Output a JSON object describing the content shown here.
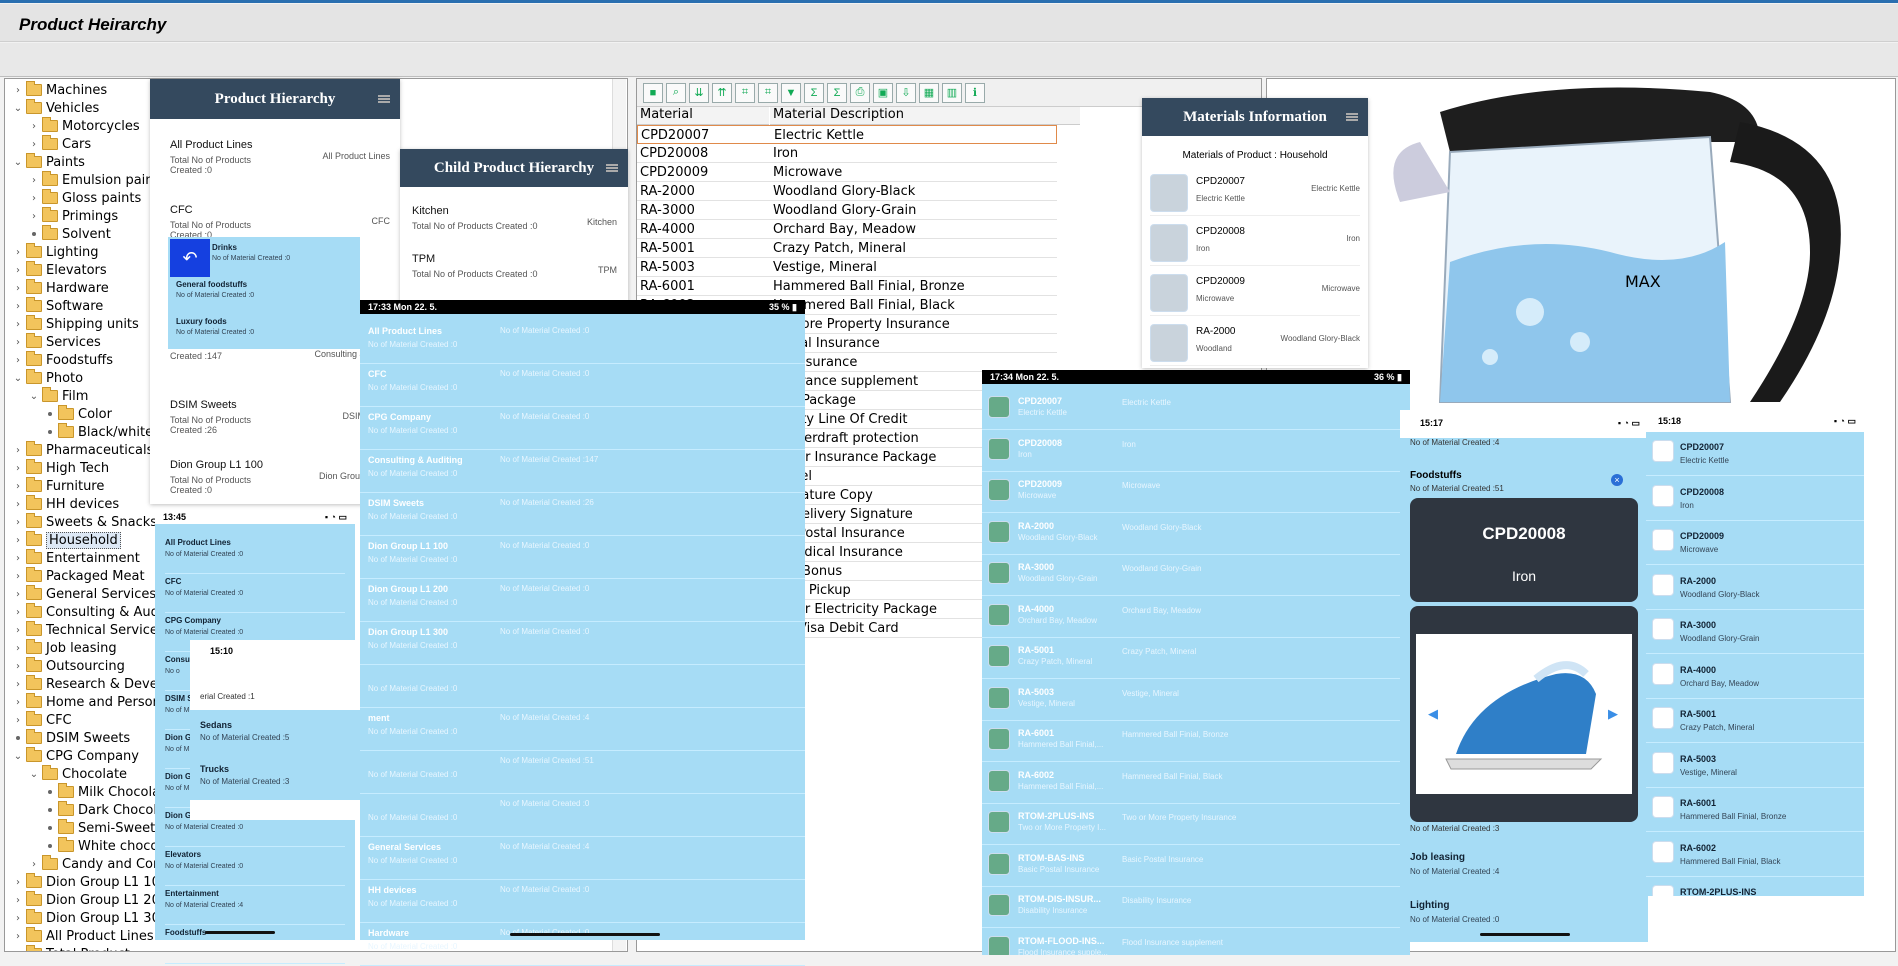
{
  "window": {
    "title": "Product Heirarchy"
  },
  "tree": [
    {
      "label": "Machines",
      "tw": "›",
      "d": 0
    },
    {
      "label": "Vehicles",
      "tw": "⌄",
      "d": 0
    },
    {
      "label": "Motorcycles",
      "tw": "›",
      "d": 1
    },
    {
      "label": "Cars",
      "tw": "›",
      "d": 1
    },
    {
      "label": "Paints",
      "tw": "⌄",
      "d": 0
    },
    {
      "label": "Emulsion paints",
      "tw": "›",
      "d": 1
    },
    {
      "label": "Gloss paints",
      "tw": "›",
      "d": 1
    },
    {
      "label": "Primings",
      "tw": "›",
      "d": 1
    },
    {
      "label": "Solvent",
      "tw": "•",
      "d": 1
    },
    {
      "label": "Lighting",
      "tw": "›",
      "d": 0
    },
    {
      "label": "Elevators",
      "tw": "›",
      "d": 0
    },
    {
      "label": "Hardware",
      "tw": "›",
      "d": 0
    },
    {
      "label": "Software",
      "tw": "›",
      "d": 0
    },
    {
      "label": "Shipping units",
      "tw": "›",
      "d": 0
    },
    {
      "label": "Services",
      "tw": "›",
      "d": 0
    },
    {
      "label": "Foodstuffs",
      "tw": "›",
      "d": 0
    },
    {
      "label": "Photo",
      "tw": "⌄",
      "d": 0
    },
    {
      "label": "Film",
      "tw": "⌄",
      "d": 1
    },
    {
      "label": "Color",
      "tw": "•",
      "d": 2
    },
    {
      "label": "Black/white",
      "tw": "•",
      "d": 2
    },
    {
      "label": "Pharmaceuticals",
      "tw": "›",
      "d": 0
    },
    {
      "label": "High Tech",
      "tw": "›",
      "d": 0
    },
    {
      "label": "Furniture",
      "tw": "›",
      "d": 0
    },
    {
      "label": "HH devices",
      "tw": "›",
      "d": 0
    },
    {
      "label": "Sweets & Snacks",
      "tw": "›",
      "d": 0
    },
    {
      "label": "Household",
      "tw": "›",
      "d": 0,
      "selected": true
    },
    {
      "label": "Entertainment",
      "tw": "›",
      "d": 0
    },
    {
      "label": "Packaged Meat",
      "tw": "›",
      "d": 0
    },
    {
      "label": "General Services",
      "tw": "›",
      "d": 0
    },
    {
      "label": "Consulting & Auditing",
      "tw": "›",
      "d": 0
    },
    {
      "label": "Technical Services",
      "tw": "›",
      "d": 0
    },
    {
      "label": "Job leasing",
      "tw": "›",
      "d": 0
    },
    {
      "label": "Outsourcing",
      "tw": "›",
      "d": 0
    },
    {
      "label": "Research & Develop",
      "tw": "›",
      "d": 0
    },
    {
      "label": "Home and Personal C",
      "tw": "›",
      "d": 0
    },
    {
      "label": "CFC",
      "tw": "›",
      "d": 0
    },
    {
      "label": "DSIM Sweets",
      "tw": "•",
      "d": 0
    },
    {
      "label": "CPG Company",
      "tw": "⌄",
      "d": 0
    },
    {
      "label": "Chocolate",
      "tw": "⌄",
      "d": 1
    },
    {
      "label": "Milk Chocolate",
      "tw": "•",
      "d": 2
    },
    {
      "label": "Dark Chocolate",
      "tw": "•",
      "d": 2
    },
    {
      "label": "Semi-Sweet C",
      "tw": "•",
      "d": 2
    },
    {
      "label": "White chocola",
      "tw": "•",
      "d": 2
    },
    {
      "label": "Candy and Confe",
      "tw": "›",
      "d": 1
    },
    {
      "label": "Dion Group L1 100",
      "tw": "›",
      "d": 0
    },
    {
      "label": "Dion Group L1 200",
      "tw": "›",
      "d": 0
    },
    {
      "label": "Dion Group L1 300",
      "tw": "›",
      "d": 0
    },
    {
      "label": "All Product Lines",
      "tw": "›",
      "d": 0
    },
    {
      "label": "Total Product",
      "tw": "›",
      "d": 0
    }
  ],
  "grid": {
    "headers": [
      "Material",
      "Material Description"
    ],
    "rows": [
      [
        "CPD20007",
        "Electric Kettle"
      ],
      [
        "CPD20008",
        "Iron"
      ],
      [
        "CPD20009",
        "Microwave"
      ],
      [
        "RA-2000",
        "Woodland Glory-Black"
      ],
      [
        "RA-3000",
        "Woodland Glory-Grain"
      ],
      [
        "RA-4000",
        "Orchard Bay, Meadow"
      ],
      [
        "RA-5001",
        "Crazy Patch, Mineral"
      ],
      [
        "RA-5003",
        "Vestige, Mineral"
      ],
      [
        "RA-6001",
        "Hammered Ball Finial, Bronze"
      ],
      [
        "RA-6002",
        "Hammered Ball Finial, Black"
      ],
      [
        "",
        "or More Property Insurance"
      ],
      [
        "",
        "Postal Insurance"
      ],
      [
        "",
        "ity Insurance"
      ],
      [
        "",
        "Insurance supplement"
      ],
      [
        "",
        "Gas Package"
      ],
      [
        "",
        "Equity Line Of Credit"
      ],
      [
        "",
        "C Overdraft protection"
      ],
      [
        "",
        "+ Car Insurance Package"
      ],
      [
        "",
        "Parcel"
      ],
      [
        "",
        "Signature Copy"
      ],
      [
        "",
        "Of Delivery Signature"
      ],
      [
        "",
        "um Postal Insurance"
      ],
      [
        "",
        "e Medical Insurance"
      ],
      [
        "",
        "tion Bonus"
      ],
      [
        "",
        "luled Pickup"
      ],
      [
        "",
        "Saver Electricity Package"
      ],
      [
        "",
        "um Visa Debit Card"
      ]
    ]
  },
  "toolbar_icons": [
    "select-all",
    "find",
    "sort-asc",
    "sort-desc",
    "search",
    "search-next",
    "filter",
    "sum",
    "subtotal",
    "print",
    "view",
    "export",
    "layout",
    "chart",
    "info"
  ],
  "ph": {
    "title": "Product Hierarchy",
    "items": [
      {
        "t": "All Product Lines",
        "s": "Total No of Products Created :0",
        "r": "All Product Lines"
      },
      {
        "t": "CFC",
        "s": "Total No of Products Created :0",
        "r": "CFC"
      },
      {
        "t": "",
        "s": "Total No of Products Created :147",
        "r": "Consulting & Auditi"
      },
      {
        "t": "DSIM Sweets",
        "s": "Total No of Products Created :26",
        "r": "DSIM Swee"
      },
      {
        "t": "Dion Group L1 100",
        "s": "Total No of Products Created :0",
        "r": "Dion Group L1 10"
      }
    ]
  },
  "popup": {
    "items": [
      {
        "t": "Drinks",
        "s": "No of Material Created :0"
      },
      {
        "t": "General foodstuffs",
        "s": "No of Material Created :0"
      },
      {
        "t": "Luxury foods",
        "s": "No of Material Created :0"
      }
    ]
  },
  "cph": {
    "title": "Child Product Hierarchy",
    "items": [
      {
        "t": "Kitchen",
        "s": "Total No of Products Created :0",
        "r": "Kitchen"
      },
      {
        "t": "TPM",
        "s": "Total No of Products Created :0",
        "r": "TPM"
      }
    ]
  },
  "phone1": {
    "time": "13:45",
    "items": [
      {
        "t": "All Product Lines",
        "s": "No of Material Created :0"
      },
      {
        "t": "CFC",
        "s": "No of Material Created :0"
      },
      {
        "t": "CPG Company",
        "s": "No of Material Created :0"
      },
      {
        "t": "Consu",
        "s": "No o"
      },
      {
        "t": "DSIM S",
        "s": "No of M"
      },
      {
        "t": "Dion G",
        "s": "No of M"
      },
      {
        "t": "Dion G",
        "s": "No of M"
      },
      {
        "t": "Dion G",
        "s": "No of Material Created :0"
      },
      {
        "t": "Elevators",
        "s": "No of Material Created :0"
      },
      {
        "t": "Entertainment",
        "s": "No of Material Created :4"
      },
      {
        "t": "Foodstuffs",
        "s": ""
      }
    ]
  },
  "phone2": {
    "time": "15:10",
    "top": "erial Created :1",
    "items": [
      {
        "t": "Sedans",
        "s": "No of Material Created :5"
      },
      {
        "t": "Trucks",
        "s": "No of Material Created :3"
      }
    ]
  },
  "tablet1": {
    "time": "17:33",
    "date": "Mon 22. 5.",
    "batt": "35 %",
    "items": [
      {
        "t": "All Product Lines",
        "r": "No of Material Created :0"
      },
      {
        "t": "CFC",
        "r": "No of Material Created :0"
      },
      {
        "t": "CPG Company",
        "r": "No of Material Created :0"
      },
      {
        "t": "Consulting & Auditing",
        "r": "No of Material Created :147"
      },
      {
        "t": "DSIM Sweets",
        "r": "No of Material Created :26"
      },
      {
        "t": "Dion Group L1 100",
        "r": "No of Material Created :0"
      },
      {
        "t": "Dion Group L1 200",
        "r": "No of Material Created :0"
      },
      {
        "t": "Dion Group L1 300",
        "r": "No of Material Created :0"
      },
      {
        "t": "",
        "r": ""
      },
      {
        "t": "ment",
        "r": "No of Material Created :4"
      },
      {
        "t": "",
        "r": "No of Material Created :51"
      },
      {
        "t": "",
        "r": "No of Material Created :0"
      },
      {
        "t": "General Services",
        "r": "No of Material Created :4"
      },
      {
        "t": "HH devices",
        "r": "No of Material Created :0"
      },
      {
        "t": "Hardware",
        "r": "No of Material Created :0"
      }
    ]
  },
  "mat": {
    "title": "Materials Information",
    "subtitle": "Materials of Product : Household",
    "items": [
      {
        "t": "CPD20007",
        "s": "Electric Kettle",
        "r": "Electric Kettle"
      },
      {
        "t": "CPD20008",
        "s": "Iron",
        "r": "Iron"
      },
      {
        "t": "CPD20009",
        "s": "Microwave",
        "r": "Microwave"
      },
      {
        "t": "RA-2000",
        "s": "Woodland",
        "r": "Woodland Glory-Black"
      }
    ]
  },
  "kettle": {
    "label": "MAX"
  },
  "tablet2": {
    "time": "17:34",
    "date": "Mon 22. 5.",
    "batt": "36 %",
    "items": [
      {
        "t": "CPD20007",
        "s": "Electric Kettle",
        "r": "Electric Kettle"
      },
      {
        "t": "CPD20008",
        "s": "Iron",
        "r": "Iron"
      },
      {
        "t": "CPD20009",
        "s": "Microwave",
        "r": "Microwave"
      },
      {
        "t": "RA-2000",
        "s": "Woodland Glory-Black",
        "r": "Woodland Glory-Black"
      },
      {
        "t": "RA-3000",
        "s": "Woodland Glory-Grain",
        "r": "Woodland Glory-Grain"
      },
      {
        "t": "RA-4000",
        "s": "Orchard Bay, Meadow",
        "r": "Orchard Bay, Meadow"
      },
      {
        "t": "RA-5001",
        "s": "Crazy Patch, Mineral",
        "r": "Crazy Patch, Mineral"
      },
      {
        "t": "RA-5003",
        "s": "Vestige, Mineral",
        "r": "Vestige, Mineral"
      },
      {
        "t": "RA-6001",
        "s": "Hammered Ball Finial,...",
        "r": "Hammered Ball Finial, Bronze"
      },
      {
        "t": "RA-6002",
        "s": "Hammered Ball Finial,...",
        "r": "Hammered Ball Finial, Black"
      },
      {
        "t": "RTOM-2PLUS-INS",
        "s": "Two or More Property I...",
        "r": "Two or More Property Insurance"
      },
      {
        "t": "RTOM-BAS-INS",
        "s": "Basic Postal Insurance",
        "r": "Basic Postal Insurance"
      },
      {
        "t": "RTOM-DIS-INSUR...",
        "s": "Disability Insurance",
        "r": "Disability Insurance"
      },
      {
        "t": "RTOM-FLOOD-INS...",
        "s": "Flood Insurance supple...",
        "r": "Flood Insurance supplement"
      }
    ]
  },
  "phone3": {
    "time": "15:17",
    "top": "No of Material Created :4",
    "items": [
      {
        "t": "Foodstuffs",
        "s": "No of Material Created :51"
      }
    ],
    "detail": {
      "code": "CPD20008",
      "name": "Iron"
    },
    "below": "No of Material Created :3",
    "after": [
      {
        "t": "Job leasing",
        "s": "No of Material Created :4"
      },
      {
        "t": "Lighting",
        "s": "No of Material Created :0"
      }
    ]
  },
  "phone4": {
    "time": "15:18",
    "items": [
      {
        "t": "CPD20007",
        "s": "Electric Kettle"
      },
      {
        "t": "CPD20008",
        "s": "Iron"
      },
      {
        "t": "CPD20009",
        "s": "Microwave"
      },
      {
        "t": "RA-2000",
        "s": "Woodland Glory-Black"
      },
      {
        "t": "RA-3000",
        "s": "Woodland Glory-Grain"
      },
      {
        "t": "RA-4000",
        "s": "Orchard Bay, Meadow"
      },
      {
        "t": "RA-5001",
        "s": "Crazy Patch, Mineral"
      },
      {
        "t": "RA-5003",
        "s": "Vestige, Mineral"
      },
      {
        "t": "RA-6001",
        "s": "Hammered Ball Finial, Bronze"
      },
      {
        "t": "RA-6002",
        "s": "Hammered Ball Finial, Black"
      },
      {
        "t": "RTOM-2PLUS-INS",
        "s": ""
      }
    ]
  }
}
